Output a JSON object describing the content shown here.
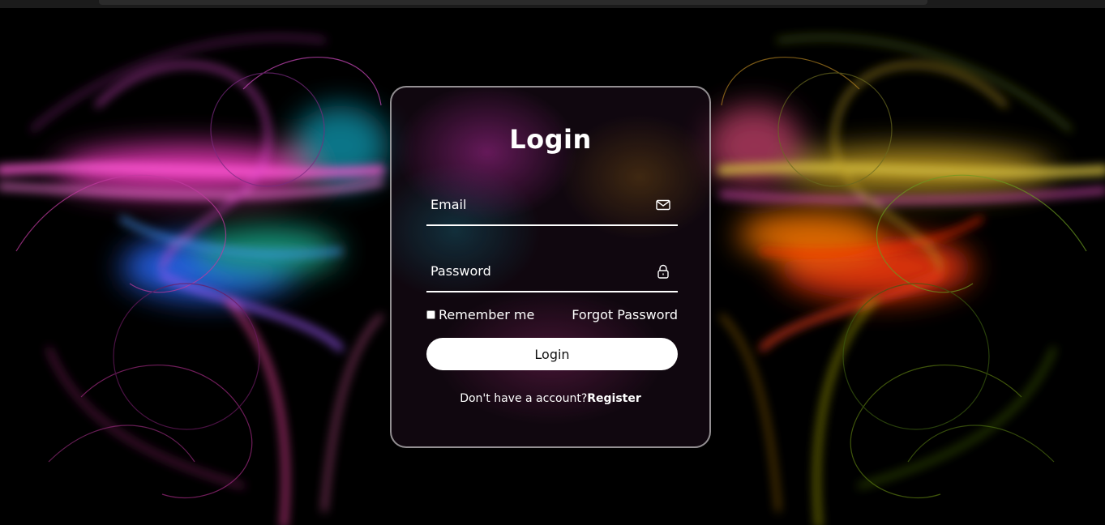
{
  "form": {
    "title": "Login",
    "email_label": "Email",
    "password_label": "Password",
    "remember_label": "Remember me",
    "forgot_label": "Forgot Password",
    "login_button": "Login",
    "no_account_text": "Don't have a account?",
    "register_link": "Register"
  },
  "icons": {
    "email": "mail-icon",
    "password": "lock-icon"
  },
  "colors": {
    "card_border": "#ffffff",
    "button_bg": "#ffffff",
    "text": "#ffffff",
    "background": "#000000"
  }
}
